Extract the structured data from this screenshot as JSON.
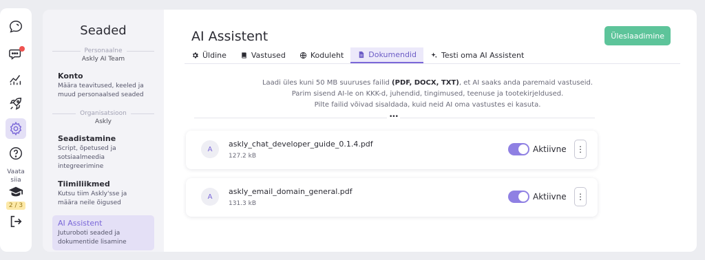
{
  "rail": {
    "items": [
      {
        "name": "chat-bubble-logo-icon"
      },
      {
        "name": "conversations-icon",
        "notification": true
      },
      {
        "name": "analytics-chart-icon"
      },
      {
        "name": "rocket-icon"
      },
      {
        "name": "settings-gear-icon",
        "active": true
      },
      {
        "name": "help-question-icon"
      }
    ],
    "guide_label": "Vaata siia",
    "guide_icon": "graduation-cap-icon",
    "guide_progress": "2 / 3",
    "logout_icon": "logout-icon",
    "accent_color": "#7a67d8",
    "notification_color": "#ef5350"
  },
  "settings_nav": {
    "title": "Seaded",
    "personal_section": {
      "label": "Personaalne",
      "sub": "Askly AI Team"
    },
    "konto": {
      "title": "Konto",
      "desc": "Määra teavitused, keeled ja muud personaalsed seaded"
    },
    "org_section": {
      "label": "Organisatsioon",
      "sub": "Askly"
    },
    "seadistamine": {
      "title": "Seadistamine",
      "desc": "Script, õpetused ja sotsiaalmeedia integreerimine"
    },
    "tiimiliikmed": {
      "title": "Tiimiliikmed",
      "desc": "Kutsu tiim Askly'sse ja määra neile õigused"
    },
    "ai_assistent": {
      "title": "AI Assistent",
      "desc": "Juturoboti seaded ja dokumentide lisamine",
      "active": true
    }
  },
  "main": {
    "title": "AI Assistent",
    "upload_label": "Üleslaadimine",
    "upload_color": "#5dc49a",
    "tabs": [
      {
        "label": "Üldine",
        "icon": "gear-icon"
      },
      {
        "label": "Vastused",
        "icon": "book-icon"
      },
      {
        "label": "Koduleht",
        "icon": "globe-icon"
      },
      {
        "label": "Dokumendid",
        "icon": "document-icon",
        "active": true
      },
      {
        "label": "Testi oma AI Assistent",
        "icon": "sparkles-icon"
      }
    ],
    "info": {
      "line1_pre": "Laadi üles kuni 50 MB suuruses failid ",
      "line1_bold": "(PDF, DOCX, TXT)",
      "line1_post": ", et AI saaks anda paremaid vastuseid.",
      "line2": "Parim sisend AI-le on KKK-d, juhendid, tingimused, teenuse ja tootekirjeldused.",
      "line3": "Pilte failid võivad sisaldada, kuid neid AI oma vastustes ei kasuta."
    },
    "divider_handle": "•••",
    "documents": [
      {
        "avatar": "A",
        "name": "askly_chat_developer_guide_0.1.4.pdf",
        "size": "127.2 kB",
        "status": "Aktiivne",
        "active": true,
        "menu": "⋮"
      },
      {
        "avatar": "A",
        "name": "askly_email_domain_general.pdf",
        "size": "131.3 kB",
        "status": "Aktiivne",
        "active": true,
        "menu": "⋮"
      }
    ]
  }
}
